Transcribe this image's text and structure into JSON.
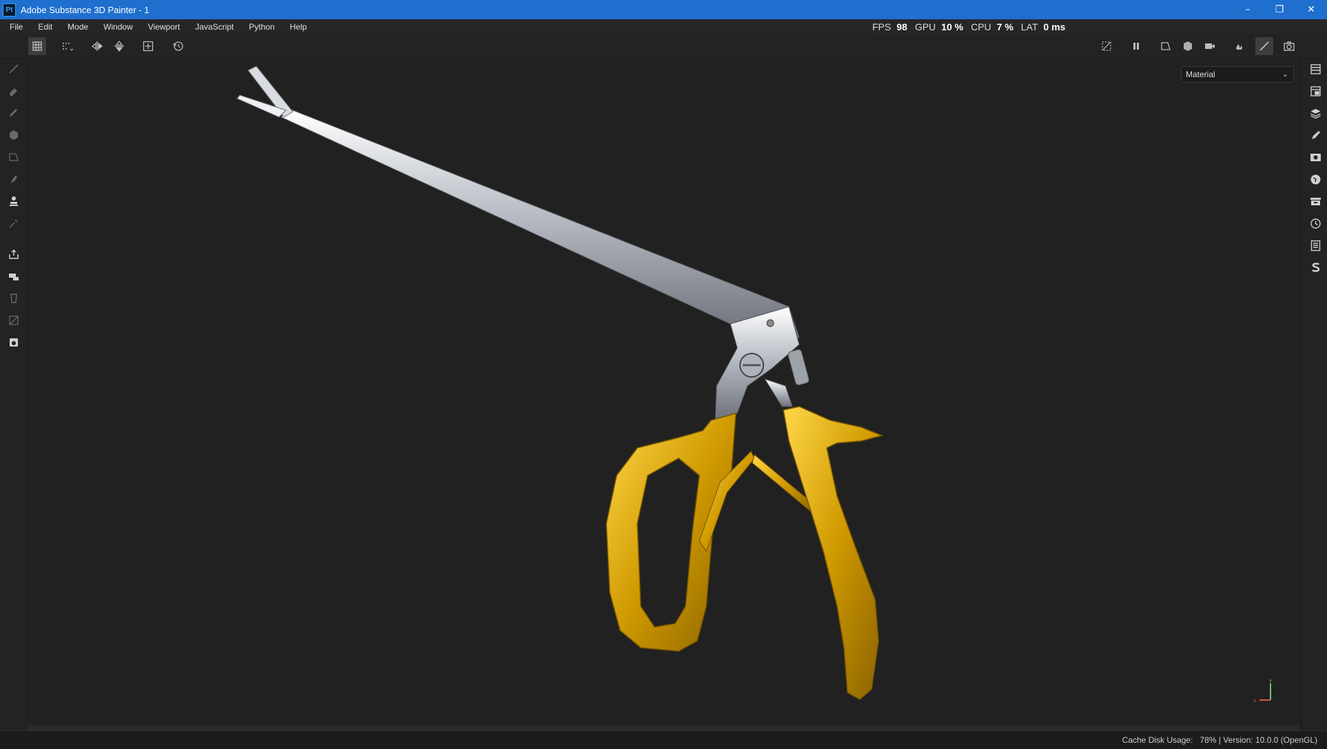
{
  "window": {
    "title": "Adobe Substance 3D Painter - 1",
    "app_logo": "Pt",
    "controls": [
      "minimize-icon",
      "restore-icon",
      "close-icon"
    ]
  },
  "menu": [
    "File",
    "Edit",
    "Mode",
    "Window",
    "Viewport",
    "JavaScript",
    "Python",
    "Help"
  ],
  "stats": {
    "fps_label": "FPS",
    "fps_value": "98",
    "gpu_label": "GPU",
    "gpu_value": "10 %",
    "cpu_label": "CPU",
    "cpu_value": "7 %",
    "lat_label": "LAT",
    "lat_value": "0 ms"
  },
  "toolbar": {
    "left_icons": [
      "uv-grid-icon",
      "selection-grid-icon",
      "mirror-x-icon",
      "mirror-y-icon",
      "fit-view-icon",
      "reset-icon"
    ],
    "right_icons": [
      "hide-icon",
      "pause-icon",
      "perspective-icon",
      "cube-view-icon",
      "camera-icon",
      "bake-icon",
      "paint-brush-icon",
      "screenshot-icon"
    ]
  },
  "left_tools": [
    "paint-icon",
    "eraser-icon",
    "projection-icon",
    "geometry-mask-icon",
    "polygon-fill-icon",
    "smudge-icon",
    "clone-icon",
    "color-picker-icon",
    "export-icon",
    "bake-mesh-icon",
    "trash-icon",
    "uv-layout-icon",
    "save-icon"
  ],
  "right_panels": [
    "layers-panel-icon",
    "texture-set-icon",
    "layer-stack-icon",
    "brush-settings-icon",
    "display-icon",
    "environment-icon",
    "shelf-icon",
    "history-icon",
    "log-icon",
    "substance-icon"
  ],
  "viewport": {
    "mode_select": "Material",
    "axis_labels": {
      "x": "x",
      "y": "y"
    },
    "colors": {
      "steel": "#c8ccd3",
      "gold": "#d7a400",
      "background": "#212121"
    }
  },
  "status": {
    "cache_label": "Cache Disk Usage:",
    "cache_value": "78%",
    "separator": "|",
    "version": "Version: 10.0.0 (OpenGL)"
  }
}
